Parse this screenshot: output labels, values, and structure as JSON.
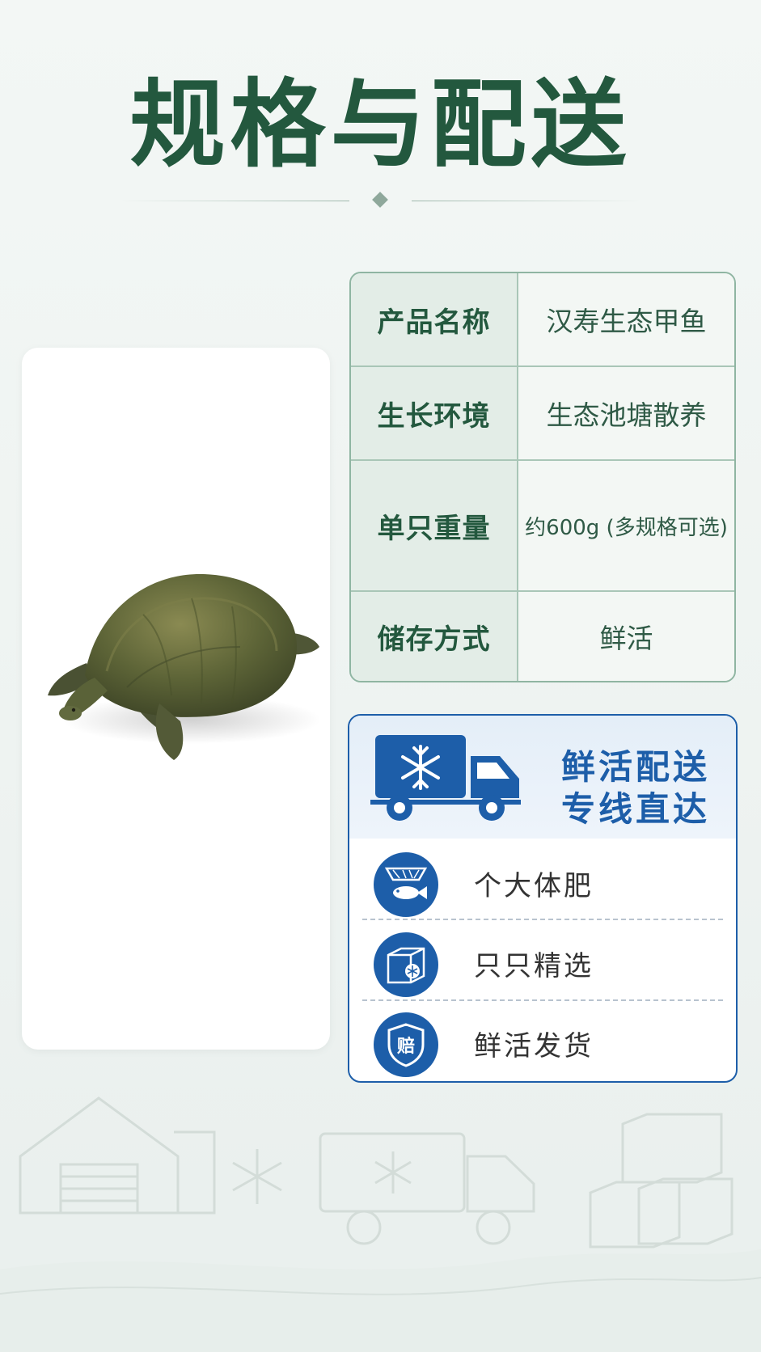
{
  "title": "规格与配送",
  "specs": [
    {
      "label": "产品名称",
      "value": "汉寿生态甲鱼"
    },
    {
      "label": "生长环境",
      "value": "生态池塘散养"
    },
    {
      "label": "单只重量",
      "value": "约600g (多规格可选)"
    },
    {
      "label": "储存方式",
      "value": "鲜活"
    }
  ],
  "delivery": {
    "line1": "鲜活配送",
    "line2": "专线直达",
    "features": [
      {
        "label": "个大体肥",
        "icon": "fish-net-icon"
      },
      {
        "label": "只只精选",
        "icon": "cold-box-icon"
      },
      {
        "label": "鲜活发货",
        "icon": "shield-compensate-icon",
        "badge_text": "赔"
      }
    ]
  },
  "colors": {
    "title_green": "#23583e",
    "accent_blue": "#1d5ea9",
    "table_border": "#8fb5a2"
  }
}
